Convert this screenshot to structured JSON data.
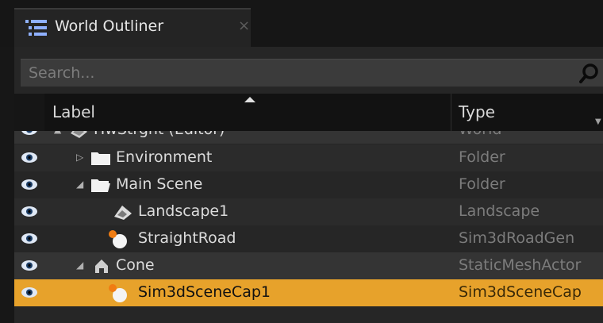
{
  "tab": {
    "title": "World Outliner",
    "icon": "list-icon",
    "close": "×"
  },
  "search": {
    "placeholder": "Search...",
    "value": ""
  },
  "columns": {
    "label": "Label",
    "type": "Type"
  },
  "rows": [
    {
      "label": "HwStrght (Editor)",
      "type": "World",
      "icon": "world-icon",
      "expander": "▲"
    },
    {
      "label": "Environment",
      "type": "Folder",
      "icon": "folder-icon",
      "expander": "▷"
    },
    {
      "label": "Main Scene",
      "type": "Folder",
      "icon": "folder-open-icon",
      "expander": "◢"
    },
    {
      "label": "Landscape1",
      "type": "Landscape",
      "icon": "landscape-icon"
    },
    {
      "label": "StraightRoad",
      "type": "Sim3dRoadGen",
      "icon": "actor-sphere-icon"
    },
    {
      "label": "Cone",
      "type": "StaticMeshActor",
      "icon": "static-mesh-icon",
      "expander": "◢"
    },
    {
      "label": "Sim3dSceneCap1",
      "type": "Sim3dSceneCap",
      "icon": "actor-sphere-icon",
      "selected": true
    }
  ],
  "colors": {
    "selection": "#e7a22b",
    "background": "#262626"
  }
}
